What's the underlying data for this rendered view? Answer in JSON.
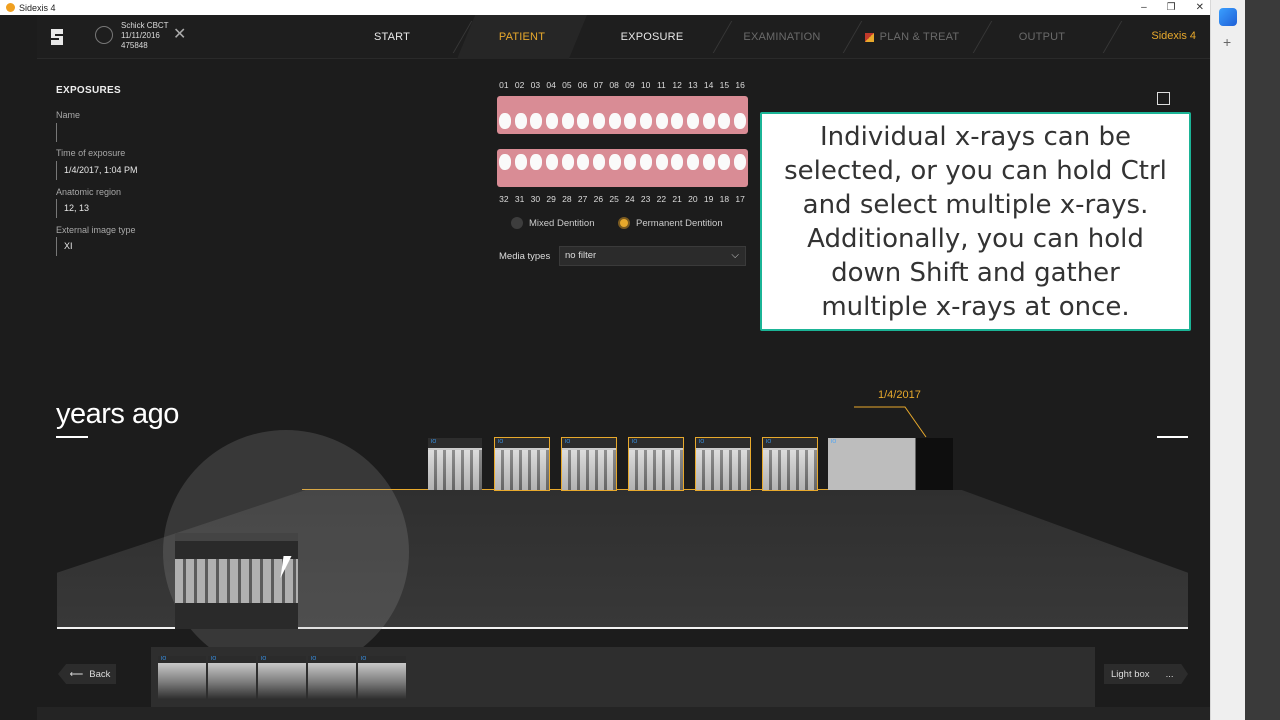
{
  "os": {
    "title": "Sidexis 4",
    "controls": [
      "–",
      "❐",
      "✕"
    ]
  },
  "patient": {
    "name": "Schick CBCT",
    "dob": "11/11/2016",
    "id": "475848"
  },
  "nav": {
    "tabs": [
      {
        "label": "START",
        "state": "normal"
      },
      {
        "label": "PATIENT",
        "state": "active"
      },
      {
        "label": "EXPOSURE",
        "state": "normal"
      },
      {
        "label": "EXAMINATION",
        "state": "disabled"
      },
      {
        "label": "PLAN & TREAT",
        "state": "disabled"
      },
      {
        "label": "OUTPUT",
        "state": "disabled"
      }
    ],
    "brand": "Sidexis 4"
  },
  "exposures": {
    "title": "EXPOSURES",
    "name_label": "Name",
    "name_value": "",
    "time_label": "Time of exposure",
    "time_value": "1/4/2017, 1:04 PM",
    "region_label": "Anatomic region",
    "region_value": "12, 13",
    "type_label": "External image type",
    "type_value": "XI"
  },
  "teeth": {
    "upper": [
      "01",
      "02",
      "03",
      "04",
      "05",
      "06",
      "07",
      "08",
      "09",
      "10",
      "11",
      "12",
      "13",
      "14",
      "15",
      "16"
    ],
    "lower": [
      "32",
      "31",
      "30",
      "29",
      "28",
      "27",
      "26",
      "25",
      "24",
      "23",
      "22",
      "21",
      "20",
      "19",
      "18",
      "17"
    ],
    "mixed_label": "Mixed Dentition",
    "permanent_label": "Permanent Dentition",
    "selected_dentition": "Permanent Dentition"
  },
  "media": {
    "label": "Media types",
    "value": "no filter"
  },
  "callout": {
    "text": "Individual x-rays can be selected, or you can hold Ctrl and select multiple x-rays. Additionally, you can hold down Shift and gather multiple x-rays at once."
  },
  "timeline": {
    "years_label": "years ago",
    "date_label": "1/4/2017",
    "io_tag": "IO"
  },
  "bottom": {
    "back_label": "Back",
    "lightbox_label": "Light box",
    "more_label": "..."
  },
  "colors": {
    "accent": "#e8a92c",
    "callout_border": "#1bb496",
    "background": "#1c1c1c"
  }
}
